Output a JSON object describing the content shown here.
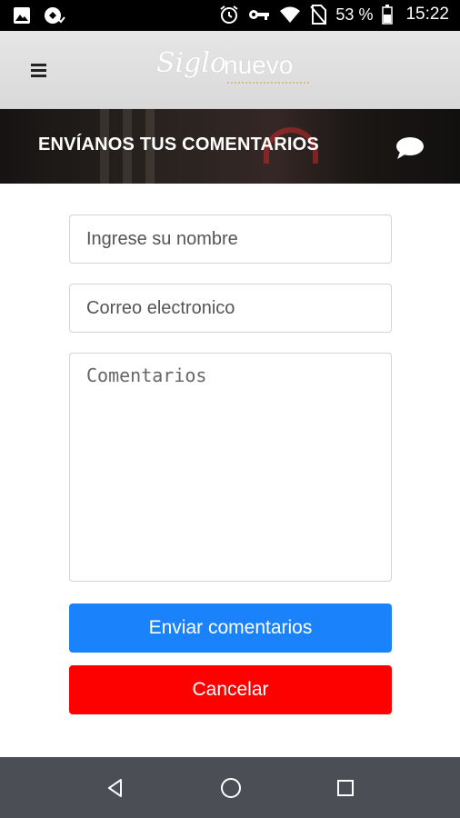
{
  "status_bar": {
    "battery": "53 %",
    "time": "15:22",
    "icons": [
      "image-icon",
      "app-icon",
      "alarm-icon",
      "key-icon",
      "wifi-icon",
      "no-sim-icon",
      "battery-icon"
    ]
  },
  "header": {
    "logo_script": "Siglo",
    "logo_word": "nuevo",
    "menu_icon": "hamburger-menu-icon"
  },
  "banner": {
    "title": "ENVÍANOS TUS COMENTARIOS",
    "icon": "chat-bubble-icon"
  },
  "form": {
    "name_placeholder": "Ingrese su nombre",
    "email_placeholder": "Correo electronico",
    "comments_placeholder": "Comentarios",
    "send_label": "Enviar comentarios",
    "cancel_label": "Cancelar"
  },
  "colors": {
    "send_button": "#1a82fb",
    "cancel_button": "#fd0000",
    "nav_bar": "#4b4e54"
  },
  "nav_bar": {
    "icons": [
      "back-icon",
      "home-icon",
      "recents-icon"
    ]
  }
}
